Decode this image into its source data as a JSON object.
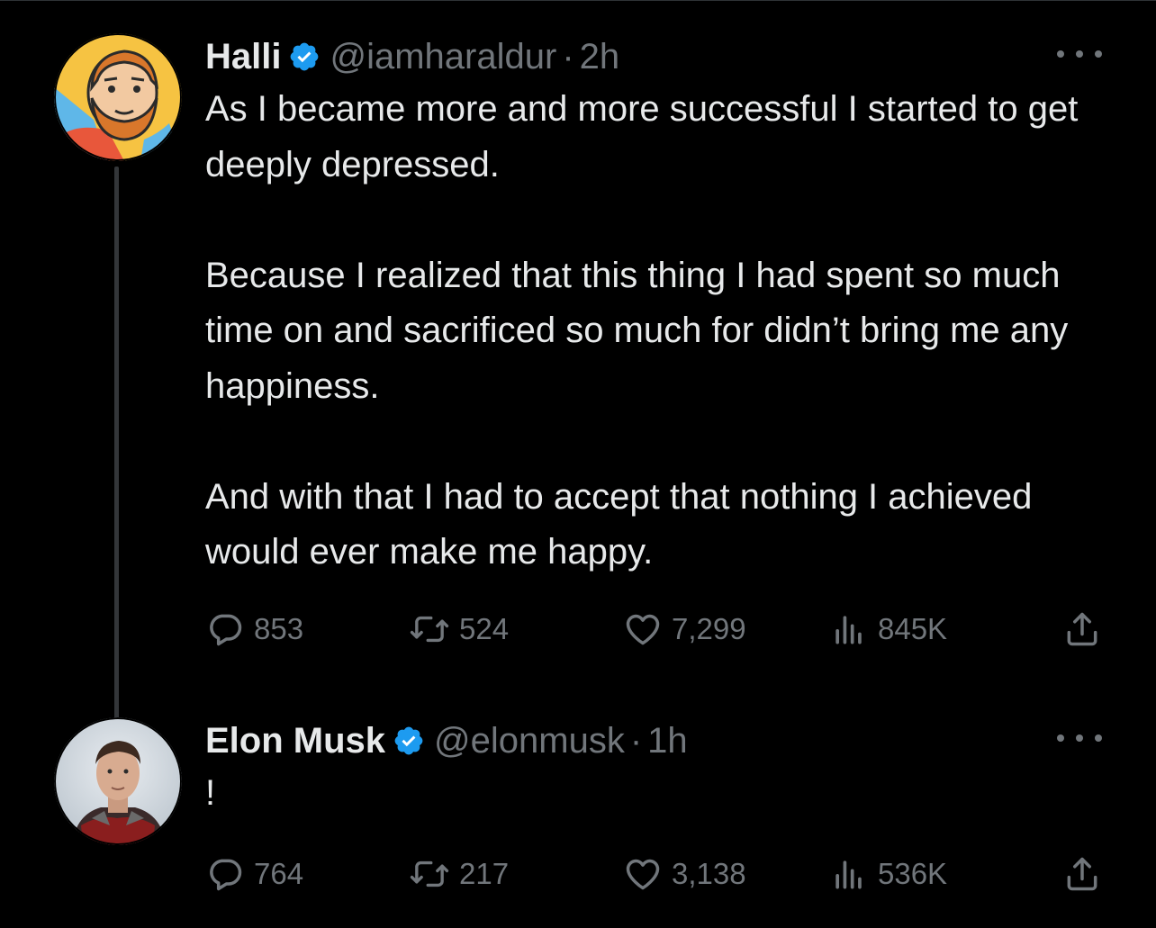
{
  "tweets": [
    {
      "author": {
        "name": "Halli",
        "handle": "@iamharaldur",
        "time": "2h",
        "verified": true,
        "avatar_icon": "cartoon-bearded-man-avatar"
      },
      "paragraphs": [
        "As I became more and more successful I started to get deeply depressed.",
        "Because I realized that this thing I had spent so much time on and sacrificed so much for didn’t bring me any happiness.",
        "And with that I had to accept that nothing I achieved would ever make me happy."
      ],
      "stats": {
        "replies": "853",
        "retweets": "524",
        "likes": "7,299",
        "views": "845K"
      }
    },
    {
      "author": {
        "name": "Elon Musk",
        "handle": "@elonmusk",
        "time": "1h",
        "verified": true,
        "avatar_icon": "photo-man-in-armor-avatar"
      },
      "paragraphs": [
        "!"
      ],
      "stats": {
        "replies": "764",
        "retweets": "217",
        "likes": "3,138",
        "views": "536K"
      }
    }
  ],
  "separator": "·",
  "colors": {
    "background": "#000000",
    "text": "#e7e9ea",
    "muted": "#71767b",
    "verified": "#1d9bf0",
    "thread_line": "#333639"
  }
}
